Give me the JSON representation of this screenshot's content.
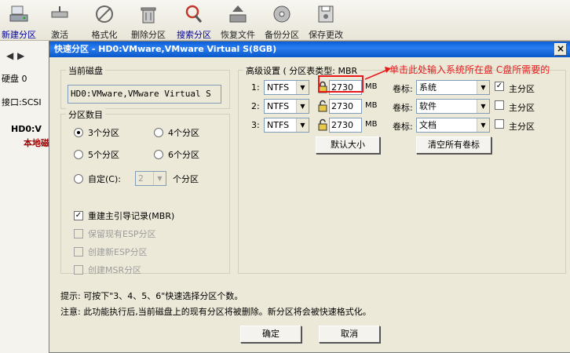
{
  "toolbar": {
    "buttons": [
      {
        "label": "新建分区",
        "icon": "hard-disk-new-icon"
      },
      {
        "label": "激活",
        "icon": "activate-icon"
      },
      {
        "label": "格式化",
        "icon": "format-icon"
      },
      {
        "label": "删除分区",
        "icon": "trash-icon"
      },
      {
        "label": "搜索分区",
        "icon": "search-icon"
      },
      {
        "label": "恢复文件",
        "icon": "recover-files-icon"
      },
      {
        "label": "备份分区",
        "icon": "backup-icon"
      },
      {
        "label": "保存更改",
        "icon": "save-icon"
      }
    ]
  },
  "left_panel": {
    "disk_label": "硬盘 0",
    "interface_label": "接口:SCSI",
    "tree_disk": "HD0:V",
    "tree_local": "本地磁"
  },
  "dialog": {
    "title": "快速分区 - HD0:VMware,VMware Virtual S(8GB)",
    "current_disk_title": "当前磁盘",
    "current_disk_value": "HD0:VMware,VMware Virtual S",
    "partition_count_title": "分区数目",
    "radio_3": "3个分区",
    "radio_4": "4个分区",
    "radio_5": "5个分区",
    "radio_6": "6个分区",
    "radio_custom": "自定(C):",
    "custom_count_value": "2",
    "custom_suffix": "个分区",
    "chk_rebuild_mbr": "重建主引导记录(MBR)",
    "chk_keep_esp": "保留现有ESP分区",
    "chk_new_esp": "创建新ESP分区",
    "chk_msr": "创建MSR分区",
    "advanced_title": "高级设置 ( 分区表类型: MBR",
    "mb_unit": "MB",
    "volume_label": "卷标:",
    "primary_label": "主分区",
    "rows": [
      {
        "index": "1:",
        "fs": "NTFS",
        "size": "2730",
        "volume": "系统",
        "primary_checked": "✓"
      },
      {
        "index": "2:",
        "fs": "NTFS",
        "size": "2730",
        "volume": "软件",
        "primary_checked": ""
      },
      {
        "index": "3:",
        "fs": "NTFS",
        "size": "2730",
        "volume": "文档",
        "primary_checked": ""
      }
    ],
    "default_size_button": "默认大小",
    "clear_labels_button": "清空所有卷标",
    "tip": "提示: 可按下\"3、4、5、6\"快速选择分区个数。",
    "warning": "注意: 此功能执行后,当前磁盘上的现有分区将被删除。新分区将会被快速格式化。",
    "ok_button": "确定",
    "cancel_button": "取消"
  },
  "annotation": {
    "text": "单击此处输入系统所在盘 C盘所需要的",
    "color": "#e8191a"
  }
}
